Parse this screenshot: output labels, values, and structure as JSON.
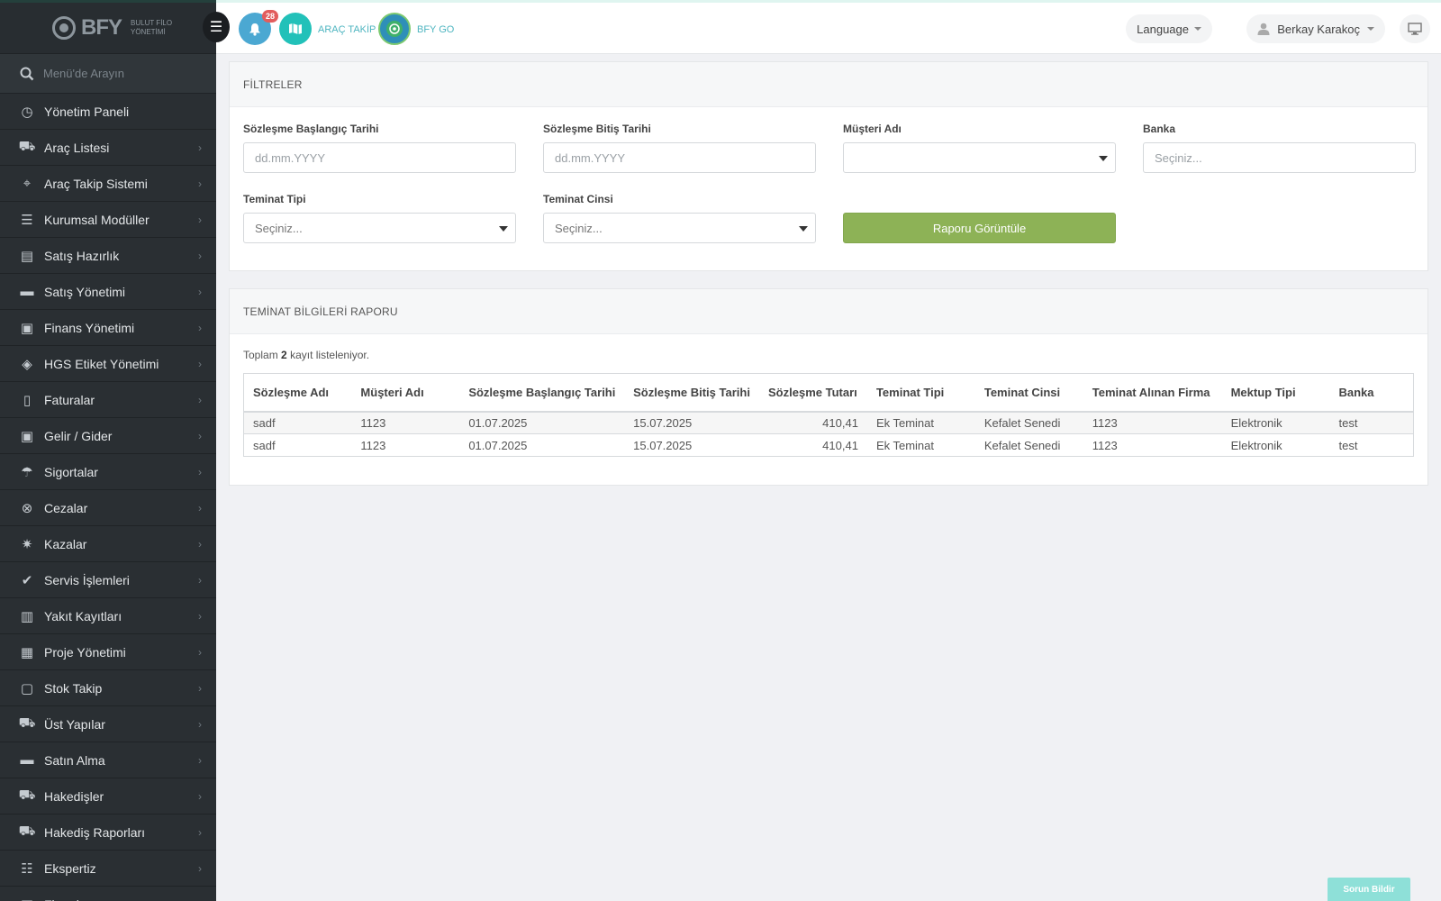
{
  "app": {
    "logo_text": "BFY",
    "logo_subtitle": "BULUT FİLO YÖNETİMİ"
  },
  "sidebar": {
    "search_placeholder": "Menü'de Arayın",
    "items": [
      {
        "label": "Yönetim Paneli",
        "icon": "dashboard-icon"
      },
      {
        "label": "Araç Listesi",
        "icon": "car-icon"
      },
      {
        "label": "Araç Takip Sistemi",
        "icon": "map-pin-icon"
      },
      {
        "label": "Kurumsal Modüller",
        "icon": "server-icon"
      },
      {
        "label": "Satış Hazırlık",
        "icon": "book-icon"
      },
      {
        "label": "Satış Yönetimi",
        "icon": "credit-card-icon"
      },
      {
        "label": "Finans Yönetimi",
        "icon": "money-icon"
      },
      {
        "label": "HGS Etiket Yönetimi",
        "icon": "tags-icon"
      },
      {
        "label": "Faturalar",
        "icon": "file-icon"
      },
      {
        "label": "Gelir / Gider",
        "icon": "money-icon"
      },
      {
        "label": "Sigortalar",
        "icon": "umbrella-icon"
      },
      {
        "label": "Cezalar",
        "icon": "times-circle-icon"
      },
      {
        "label": "Kazalar",
        "icon": "car-crash-icon"
      },
      {
        "label": "Servis İşlemleri",
        "icon": "check-circle-icon"
      },
      {
        "label": "Yakıt Kayıtları",
        "icon": "gas-pump-icon"
      },
      {
        "label": "Proje Yönetimi",
        "icon": "briefcase-icon"
      },
      {
        "label": "Stok Takip",
        "icon": "inbox-icon"
      },
      {
        "label": "Üst Yapılar",
        "icon": "truck-icon"
      },
      {
        "label": "Satın Alma",
        "icon": "credit-card-icon"
      },
      {
        "label": "Hakedişler",
        "icon": "truck-icon"
      },
      {
        "label": "Hakediş Raporları",
        "icon": "truck-icon"
      },
      {
        "label": "Ekspertiz",
        "icon": "list-alt-icon"
      },
      {
        "label": "Firmalar",
        "icon": "building-icon"
      }
    ]
  },
  "topbar": {
    "notification_count": "28",
    "arac_takip_label": "ARAÇ TAKİP",
    "bfy_go_label": "BFY GO",
    "language_label": "Language",
    "user_name": "Berkay Karakoç"
  },
  "filters": {
    "title": "FİLTRELER",
    "start_date_label": "Sözleşme Başlangıç Tarihi",
    "start_date_placeholder": "dd.mm.YYYY",
    "end_date_label": "Sözleşme Bitiş Tarihi",
    "end_date_placeholder": "dd.mm.YYYY",
    "customer_label": "Müşteri Adı",
    "customer_value": "",
    "bank_label": "Banka",
    "bank_placeholder": "Seçiniz...",
    "collateral_type_label": "Teminat Tipi",
    "collateral_type_value": "Seçiniz...",
    "collateral_kind_label": "Teminat Cinsi",
    "collateral_kind_value": "Seçiniz...",
    "submit_label": "Raporu Görüntüle"
  },
  "report": {
    "title": "TEMİNAT BİLGİLERİ RAPORU",
    "summary_prefix": "Toplam",
    "summary_count": "2",
    "summary_suffix": "kayıt listeleniyor.",
    "columns": [
      "Sözleşme Adı",
      "Müşteri Adı",
      "Sözleşme Başlangıç Tarihi",
      "Sözleşme Bitiş Tarihi",
      "Sözleşme Tutarı",
      "Teminat Tipi",
      "Teminat Cinsi",
      "Teminat Alınan Firma",
      "Mektup Tipi",
      "Banka"
    ],
    "rows": [
      [
        "sadf",
        "1123",
        "01.07.2025",
        "15.07.2025",
        "410,41",
        "Ek Teminat",
        "Kefalet Senedi",
        "1123",
        "Elektronik",
        "test"
      ],
      [
        "sadf",
        "1123",
        "01.07.2025",
        "15.07.2025",
        "410,41",
        "Ek Teminat",
        "Kefalet Senedi",
        "1123",
        "Elektronik",
        "test"
      ]
    ]
  },
  "report_issue_label": "Sorun Bildir",
  "colors": {
    "sidebar_bg": "#2a2f33",
    "primary_button": "#8db256",
    "notification_bg": "#4ba8d2",
    "map_bg": "#22c1b9",
    "badge": "#e25d5d"
  }
}
